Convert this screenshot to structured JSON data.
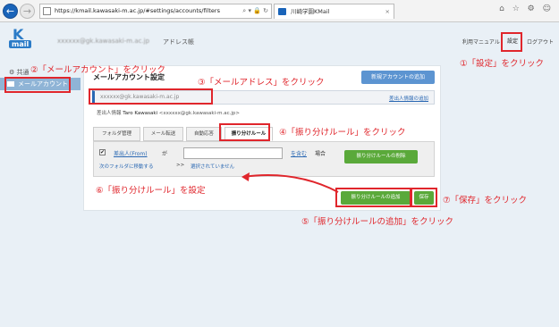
{
  "browser": {
    "url": "https://kmail.kawasaki-m.ac.jp/#settings/accounts/filters",
    "tab_title": "川崎学園KMail",
    "tab_close": "×",
    "addr_tools": "⌕ ▾ 🔒 ↻",
    "icons": "⌂ ☆ ⚙ ☺"
  },
  "header": {
    "logo_top": "K",
    "logo_bottom": "mail",
    "user": "xxxxxx@gk.kawasaki-m.ac.jp",
    "address_book": "アドレス帳",
    "manual": "利用マニュアル",
    "settings": "設定",
    "logout": "ログアウト"
  },
  "sidebar": {
    "common": "共通",
    "mail_account": "メールアカウント"
  },
  "panel": {
    "title": "メールアカウント設定",
    "new_account": "新規アカウントの追加",
    "email": "xxxxxx@gk.kawasaki-m.ac.jp",
    "add_sender": "差出人情報の追加",
    "sender_label": "差出人情報",
    "sender_name": "Taro Kawasaki",
    "sender_email": "<xxxxxx@gk.kawasaki-m.ac.jp>",
    "tabs": [
      "フォルダ管理",
      "メール転送",
      "自動応答",
      "振り分けルール"
    ],
    "rule": {
      "from": "差出人(From)",
      "ga": "が",
      "contains": "を含む",
      "baai": "場合",
      "move": "次のフォルダに移動する",
      "arrow": ">>",
      "not_set": "選択されていません",
      "delete": "振り分けルールの削除"
    },
    "add_rule": "振り分けルールの追加",
    "save": "保存"
  },
  "annotations": {
    "a1": "①「設定」をクリック",
    "a2": "②「メールアカウント」をクリック",
    "a3": "③「メールアドレス」をクリック",
    "a4": "④「振り分けルール」をクリック",
    "a5": "⑤「振り分けルールの追加」をクリック",
    "a6": "⑥「振り分けルール」を設定",
    "a7": "⑦「保存」をクリック"
  },
  "colors": {
    "annotation": "#e0262c",
    "primary": "#5c94d1",
    "green": "#5aa93a"
  }
}
